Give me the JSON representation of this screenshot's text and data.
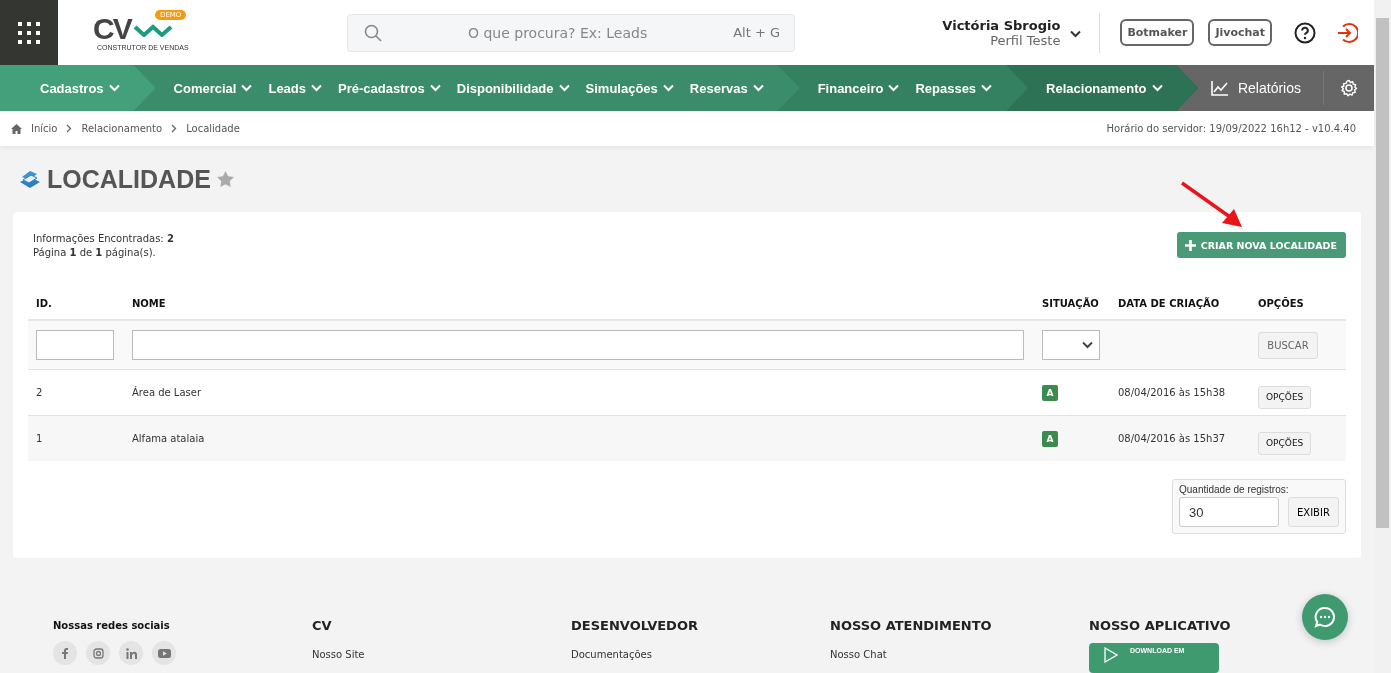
{
  "header": {
    "logo": {
      "letters": "CV",
      "badge": "DEMO",
      "tagline": "CONSTRUTOR DE VENDAS"
    },
    "search": {
      "placeholder": "O que procura? Ex: Leads",
      "shortcut": "Alt + G"
    },
    "user": {
      "name": "Victória Sbrogio",
      "profile": "Perfil Teste"
    },
    "buttons": [
      "Botmaker",
      "Jivochat"
    ]
  },
  "nav": {
    "groups": [
      {
        "color": "#43a07a",
        "items": [
          "Cadastros"
        ]
      },
      {
        "color": "#3b8c6a",
        "items": [
          "Comercial",
          "Leads",
          "Pré-cadastros",
          "Disponibilidade",
          "Simulações",
          "Reservas"
        ]
      },
      {
        "color": "#338160",
        "items": [
          "Financeiro",
          "Repasses"
        ]
      },
      {
        "color": "#2d7254",
        "items": [
          "Relacionamento"
        ]
      }
    ],
    "reports": "Relatórios"
  },
  "breadcrumb": {
    "items": [
      "Início",
      "Relacionamento",
      "Localidade"
    ],
    "server_info": "Horário do servidor: 19/09/2022 16h12 - v10.4.40"
  },
  "page": {
    "title": "LOCALIDADE",
    "favorite": false,
    "info_lines": [
      "Informações Encontradas: **2**",
      "Página **1** de **1** página(s)."
    ],
    "create_button": "CRIAR NOVA LOCALIDADE"
  },
  "table": {
    "columns": [
      "ID.",
      "NOME",
      "SITUAÇÃO",
      "DATA DE CRIAÇÃO",
      "OPÇÕES"
    ],
    "search_button": "BUSCAR",
    "rows": [
      {
        "id": "2",
        "name": "Área de Laser",
        "status": "A",
        "created": "08/04/2016 às 15h38",
        "options": "OPÇÕES"
      },
      {
        "id": "1",
        "name": "Alfama atalaia",
        "status": "A",
        "created": "08/04/2016 às 15h37",
        "options": "OPÇÕES"
      }
    ]
  },
  "page_size": {
    "label": "Quantidade de registros:",
    "value": "30",
    "button": "EXIBIR"
  },
  "footer": {
    "social_title": "Nossas redes sociais",
    "columns": [
      {
        "title": "CV",
        "link": "Nosso Site"
      },
      {
        "title": "DESENVOLVEDOR",
        "link": "Documentações"
      },
      {
        "title": "NOSSO ATENDIMENTO",
        "link": "Nosso Chat"
      },
      {
        "title": "NOSSO APLICATIVO",
        "badge": "DOWNLOAD EM"
      }
    ]
  }
}
